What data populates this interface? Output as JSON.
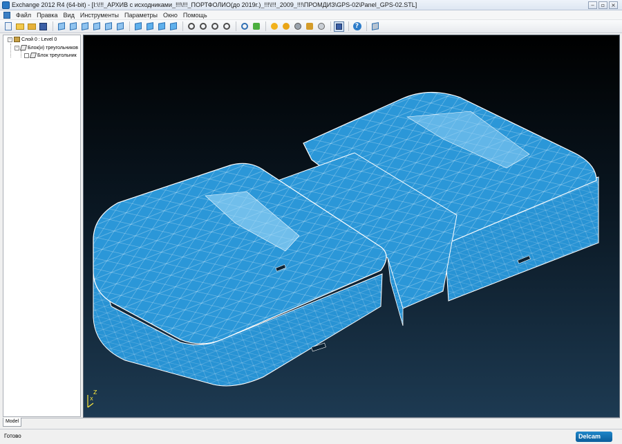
{
  "window": {
    "title": "Exchange 2012 R4 (64-bit) - [I:\\!!!_АРХИВ с исходниками_!!!\\!!!_ПОРТФОЛИО(до 2019г.)_!!!\\!!!_2009_!!!\\ПРОМДИЗ\\GPS-02\\Panel_GPS-02.STL]",
    "buttons": [
      "minimize",
      "maximize",
      "close"
    ]
  },
  "menubar": {
    "items": [
      "Файл",
      "Правка",
      "Вид",
      "Инструменты",
      "Параметры",
      "Окно",
      "Помощь"
    ]
  },
  "toolbar": {
    "icons": [
      "new-icon",
      "open-icon",
      "import-icon",
      "save-icon",
      "view-iso-1-icon",
      "view-iso-2-icon",
      "view-iso-3-icon",
      "view-iso-4-icon",
      "view-iso-5-icon",
      "view-iso-6-icon",
      "view-front-icon",
      "view-top-icon",
      "view-side-icon",
      "view-back-icon",
      "zoom-icon",
      "zoom-in-icon",
      "zoom-out-icon",
      "zoom-fit-icon",
      "zoom-box-icon",
      "refresh-icon",
      "shade-icon",
      "light-icon",
      "globe-icon",
      "pick-icon",
      "rotate-icon",
      "active-mode-icon",
      "help-icon",
      "settings-icon"
    ]
  },
  "tree": {
    "layer": "Слой 0 : Level 0",
    "block_group": "Блок(и) треугольников",
    "block_item": "Блок треугольник"
  },
  "viewport": {
    "axis_z": "Z",
    "axis_x": "X"
  },
  "tabs": [
    "Model"
  ],
  "status": {
    "text": "Готово",
    "logo": "Delcam"
  },
  "colors": {
    "viewport_bg_top": "#000000",
    "viewport_bg_bottom": "#1d3a52",
    "mesh_fill": "#2b97d8",
    "mesh_wire": "#ffffff"
  }
}
